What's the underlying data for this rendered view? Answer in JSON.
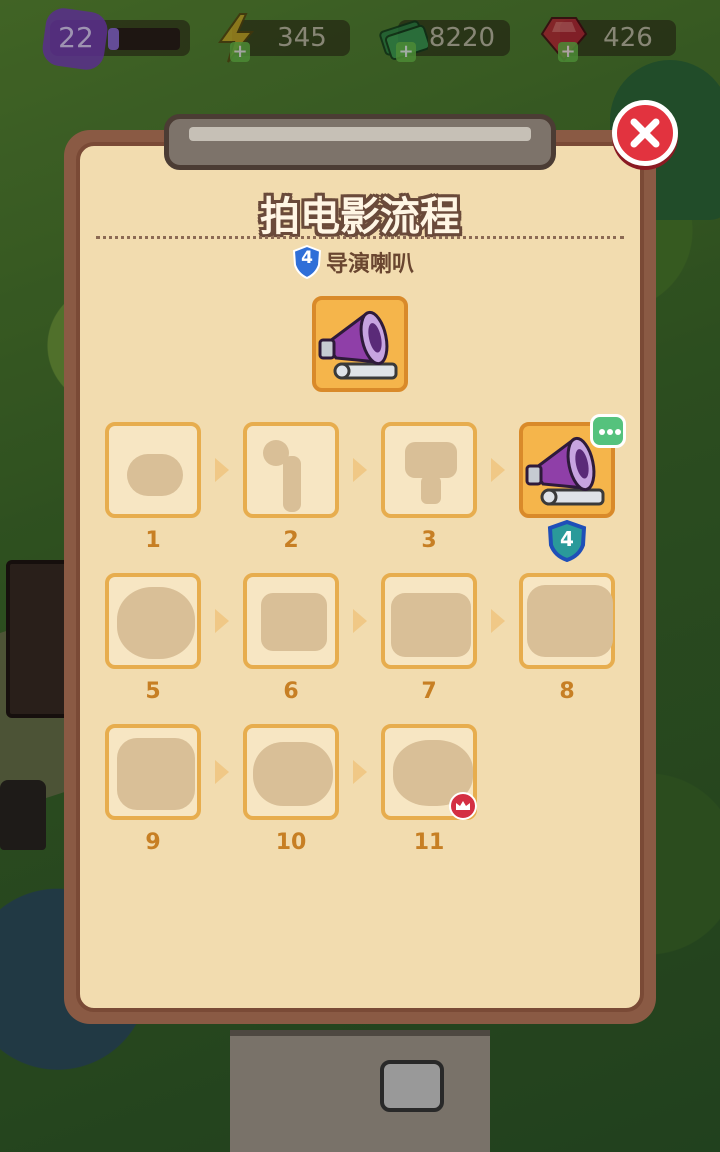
{
  "hud": {
    "level": "22",
    "level_progress": 0.15,
    "energy": "345",
    "cash": "8220",
    "gems": "426"
  },
  "panel": {
    "title": "拍电影流程",
    "subtitle": {
      "badge_level": "4",
      "label": "导演喇叭"
    },
    "steps": [
      {
        "number": "1",
        "state": "locked",
        "icon": "trophy-silhouette-icon"
      },
      {
        "number": "2",
        "state": "locked",
        "icon": "boom-mic-silhouette-icon"
      },
      {
        "number": "3",
        "state": "locked",
        "icon": "spotlight-silhouette-icon"
      },
      {
        "number": "",
        "state": "current",
        "icon": "megaphone-icon",
        "badge_level": "4"
      },
      {
        "number": "5",
        "state": "locked",
        "icon": "film-reel-silhouette-icon"
      },
      {
        "number": "6",
        "state": "locked",
        "icon": "clapper-silhouette-icon"
      },
      {
        "number": "7",
        "state": "locked",
        "icon": "camera-silhouette-icon"
      },
      {
        "number": "8",
        "state": "locked",
        "icon": "lights-silhouette-icon"
      },
      {
        "number": "9",
        "state": "locked",
        "icon": "chair-silhouette-icon"
      },
      {
        "number": "10",
        "state": "locked",
        "icon": "crane-silhouette-icon"
      },
      {
        "number": "11",
        "state": "locked",
        "icon": "studio-silhouette-icon",
        "crown": true
      }
    ]
  },
  "colors": {
    "panel_bg": "#f2dcaf",
    "card_locked": "#f7e6c3",
    "card_active": "#f5b54b",
    "number_text": "#c77f24",
    "close_red": "#e2333f"
  }
}
